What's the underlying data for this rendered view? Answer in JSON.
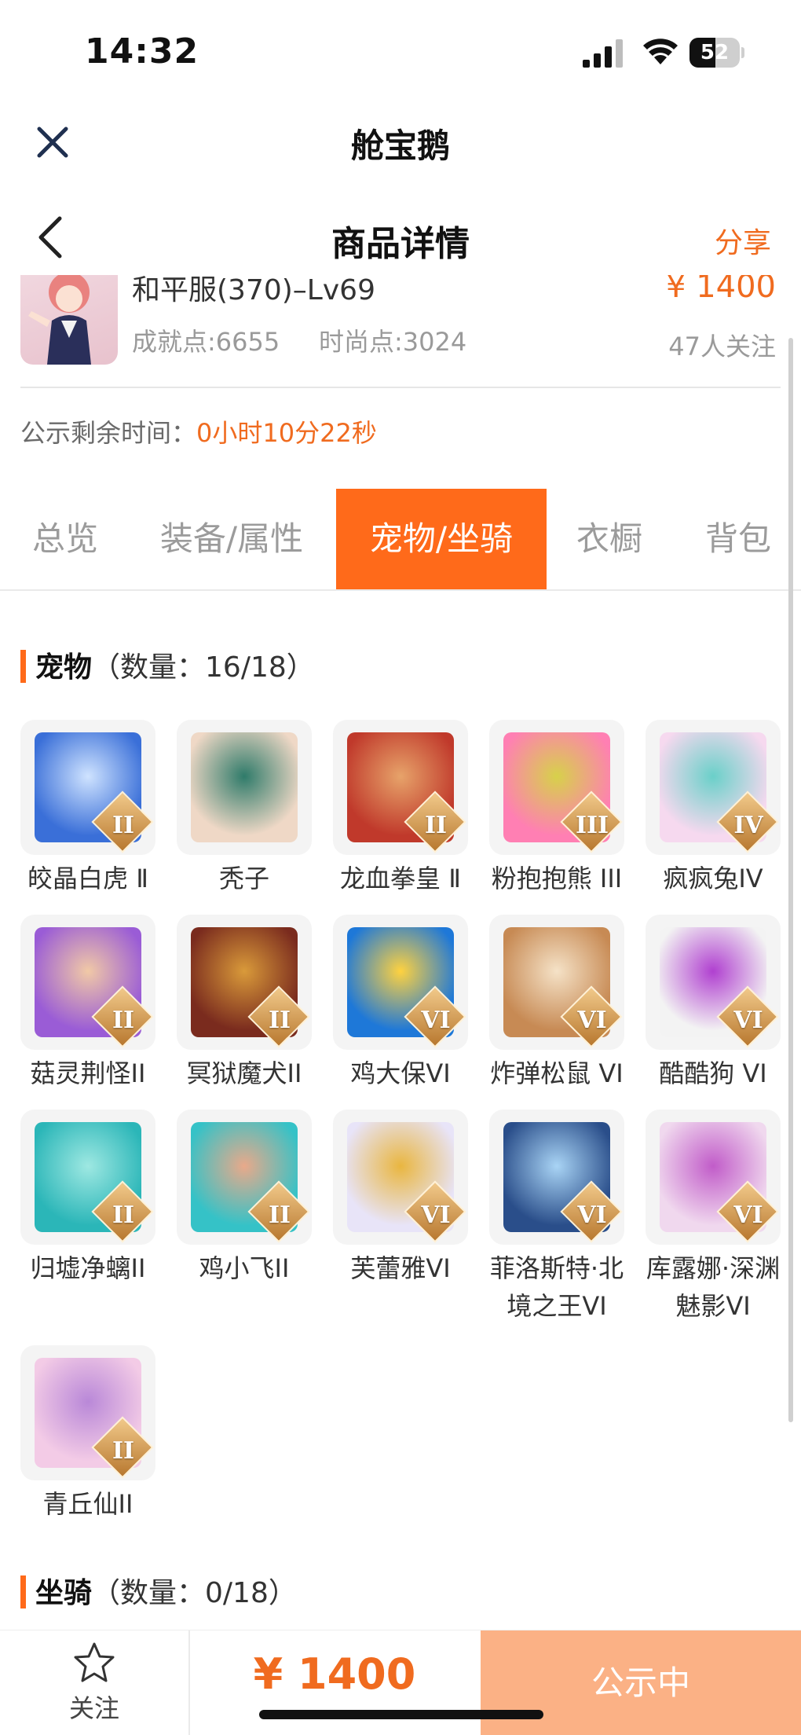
{
  "status_bar": {
    "time": "14:32",
    "battery": "52",
    "battery_level_percent": 52
  },
  "top_bar": {
    "app_title": "舱宝鹅",
    "close_icon": "close-icon"
  },
  "nav": {
    "back_icon": "chevron-left-icon",
    "title": "商品详情",
    "share": "分享"
  },
  "product": {
    "name": "和平服(370)–Lv69",
    "price": "¥ 1400",
    "achievement": "成就点:6655",
    "fashion": "时尚点:3024",
    "followers": "47人关注"
  },
  "countdown": {
    "label": "公示剩余时间：",
    "value": "0小时10分22秒"
  },
  "tabs": [
    {
      "label": "总览",
      "active": false
    },
    {
      "label": "装备/属性",
      "active": false
    },
    {
      "label": "宠物/坐骑",
      "active": true
    },
    {
      "label": "衣橱",
      "active": false
    },
    {
      "label": "背包",
      "active": false
    }
  ],
  "pets_section": {
    "title": "宠物",
    "count": "（数量：16/18）"
  },
  "pets": [
    {
      "name": "皎晶白虎 Ⅱ",
      "roman": "II",
      "colors": [
        "#3a6fd8",
        "#cfe3ff"
      ]
    },
    {
      "name": "秃子",
      "roman": "",
      "colors": [
        "#efd8c6",
        "#2f7b6a"
      ]
    },
    {
      "name": "龙血拳皇 Ⅱ",
      "roman": "II",
      "colors": [
        "#c0392b",
        "#e7a36a"
      ]
    },
    {
      "name": "粉抱抱熊 III",
      "roman": "III",
      "colors": [
        "#ff7fb3",
        "#d7d14a"
      ]
    },
    {
      "name": "疯疯兔IV",
      "roman": "IV",
      "colors": [
        "#f6d9ef",
        "#6ad0c9"
      ]
    },
    {
      "name": "菇灵荆怪II",
      "roman": "II",
      "colors": [
        "#9a5cd6",
        "#f1c9a6"
      ]
    },
    {
      "name": "冥狱魔犬II",
      "roman": "II",
      "colors": [
        "#7a2b1e",
        "#d99a3a"
      ]
    },
    {
      "name": "鸡大保VI",
      "roman": "VI",
      "colors": [
        "#1e78d8",
        "#ffd23f"
      ]
    },
    {
      "name": "炸弹松鼠 VI",
      "roman": "VI",
      "colors": [
        "#c78a54",
        "#f5e2c7"
      ]
    },
    {
      "name": "酷酷狗 VI",
      "roman": "VI",
      "colors": [
        "#f3f3f3",
        "#b040d0"
      ]
    },
    {
      "name": "归墟净螭II",
      "roman": "II",
      "colors": [
        "#2bb6b8",
        "#9ee8e2"
      ]
    },
    {
      "name": "鸡小飞II",
      "roman": "II",
      "colors": [
        "#35c2c7",
        "#e9a98a"
      ]
    },
    {
      "name": "芙蕾雅VI",
      "roman": "VI",
      "colors": [
        "#e8e4f8",
        "#e9b640"
      ]
    },
    {
      "name": "菲洛斯特·北境之王VI",
      "roman": "VI",
      "colors": [
        "#2a4e8a",
        "#a9d4f5"
      ]
    },
    {
      "name": "库露娜·深渊魅影VI",
      "roman": "VI",
      "colors": [
        "#f0d8ee",
        "#c15cc9"
      ]
    },
    {
      "name": "青丘仙II",
      "roman": "II",
      "colors": [
        "#f3cbe6",
        "#b988d8"
      ]
    }
  ],
  "mounts_section": {
    "title": "坐骑",
    "count": "（数量：0/18）"
  },
  "bottom": {
    "follow": "关注",
    "star_icon": "star-icon",
    "price": "¥ 1400",
    "status": "公示中"
  },
  "colors": {
    "accent": "#ff6a1a",
    "accent_text": "#f06b1f",
    "status_button": "#fbb185"
  }
}
